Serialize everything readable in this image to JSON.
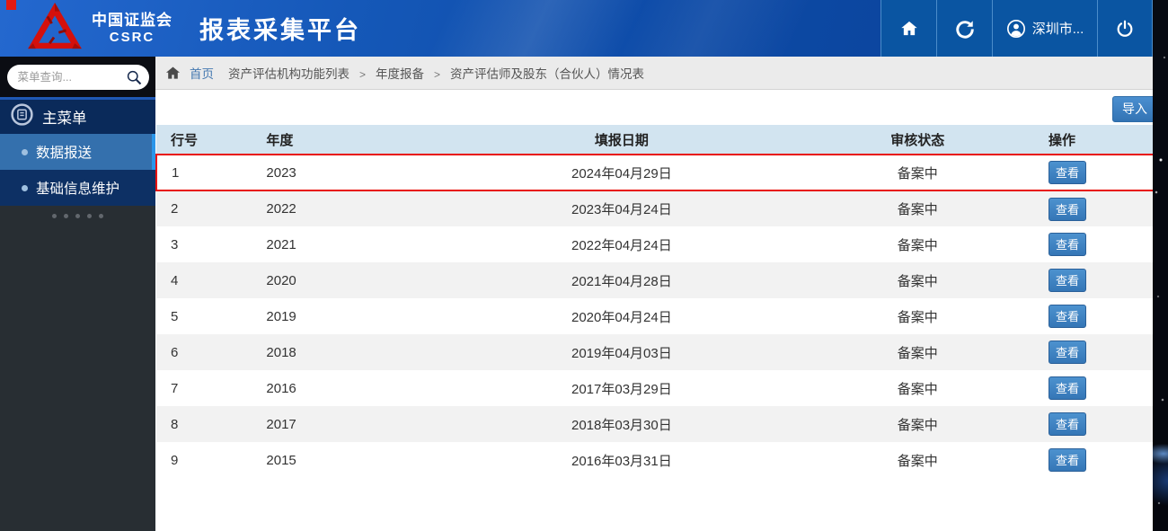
{
  "header": {
    "org_cn": "中国证监会",
    "org_en": "CSRC",
    "app_title": "报表采集平台",
    "user_label": "深圳市..."
  },
  "sidebar": {
    "search_placeholder": "菜单查询...",
    "main_menu_label": "主菜单",
    "items": [
      {
        "id": "data-reporting",
        "label": "数据报送",
        "active": true
      },
      {
        "id": "basic-info-maintenance",
        "label": "基础信息维护",
        "active": false
      }
    ]
  },
  "breadcrumb": {
    "home_label": "首页",
    "separator": ">",
    "items": [
      "资产评估机构功能列表",
      "年度报备",
      "资产评估师及股东（合伙人）情况表"
    ]
  },
  "toolbar": {
    "import_label": "导入"
  },
  "table": {
    "columns": [
      "行号",
      "年度",
      "填报日期",
      "审核状态",
      "操作"
    ],
    "view_label": "查看",
    "rows": [
      {
        "no": "1",
        "year": "2023",
        "date": "2024年04月29日",
        "status": "备案中",
        "highlighted": true
      },
      {
        "no": "2",
        "year": "2022",
        "date": "2023年04月24日",
        "status": "备案中",
        "highlighted": false
      },
      {
        "no": "3",
        "year": "2021",
        "date": "2022年04月24日",
        "status": "备案中",
        "highlighted": false
      },
      {
        "no": "4",
        "year": "2020",
        "date": "2021年04月28日",
        "status": "备案中",
        "highlighted": false
      },
      {
        "no": "5",
        "year": "2019",
        "date": "2020年04月24日",
        "status": "备案中",
        "highlighted": false
      },
      {
        "no": "6",
        "year": "2018",
        "date": "2019年04月03日",
        "status": "备案中",
        "highlighted": false
      },
      {
        "no": "7",
        "year": "2016",
        "date": "2017年03月29日",
        "status": "备案中",
        "highlighted": false
      },
      {
        "no": "8",
        "year": "2017",
        "date": "2018年03月30日",
        "status": "备案中",
        "highlighted": false
      },
      {
        "no": "9",
        "year": "2015",
        "date": "2016年03月31日",
        "status": "备案中",
        "highlighted": false
      }
    ]
  },
  "colors": {
    "header_blue": "#11519f",
    "highlight_red": "#e8120c",
    "table_header_bg": "#d2e4f0",
    "active_menu_bg": "#3470ad",
    "button_blue": "#3a7fc1",
    "sidebar_dark": "#282e33"
  }
}
